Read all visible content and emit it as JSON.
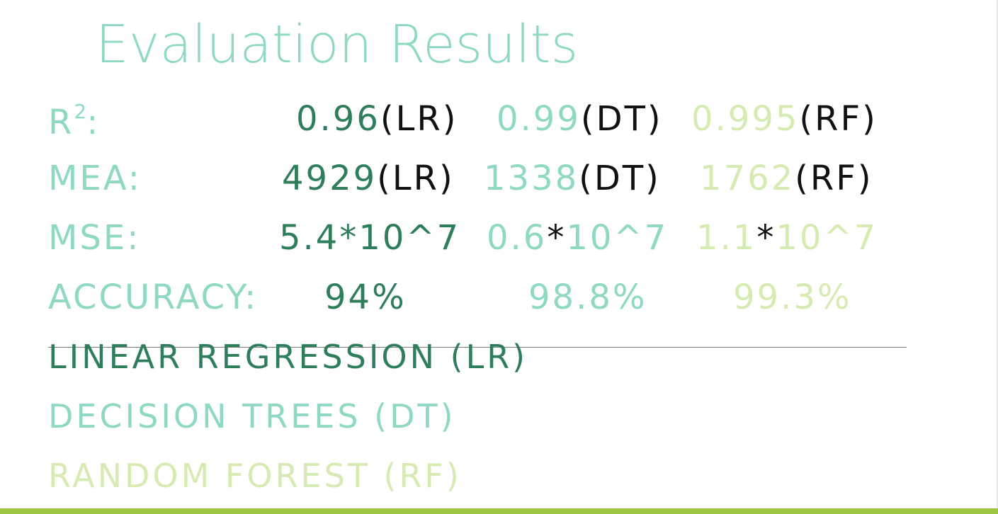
{
  "title": "Evaluation Results",
  "metrics": [
    {
      "label_main": "R",
      "label_sup": "2",
      "label_suffix": ":",
      "lr": {
        "value": "0.96",
        "tag": "(LR)"
      },
      "dt": {
        "value": "0.99",
        "tag": "(DT)"
      },
      "rf": {
        "value": "0.995",
        "tag": "(RF)"
      }
    },
    {
      "label": "MEA:",
      "lr": {
        "value": "4929",
        "tag": "(LR)"
      },
      "dt": {
        "value": "1338",
        "tag": "(DT)"
      },
      "rf": {
        "value": "1762",
        "tag": "(RF)"
      }
    },
    {
      "label": "MSE:",
      "lr": {
        "a": "5.4",
        "star": "*",
        "b": "10^7"
      },
      "dt": {
        "a": "0.6",
        "star": "*",
        "b": "10^7"
      },
      "rf": {
        "a": "1.1",
        "star": "*",
        "b": "10^7"
      }
    },
    {
      "label": "ACCURACY:",
      "lr": {
        "value": "94%"
      },
      "dt": {
        "value": "98.8%"
      },
      "rf": {
        "value": "99.3%"
      }
    }
  ],
  "legend": [
    "LINEAR REGRESSION (LR)",
    "DECISION TREES (DT)",
    "RANDOM FOREST (RF)"
  ],
  "colors": {
    "title": "#8ed8c4",
    "lr": "#2e7d5b",
    "dt": "#8ed8c4",
    "rf": "#d6ebb2",
    "accent_bar": "#9cc63f"
  }
}
